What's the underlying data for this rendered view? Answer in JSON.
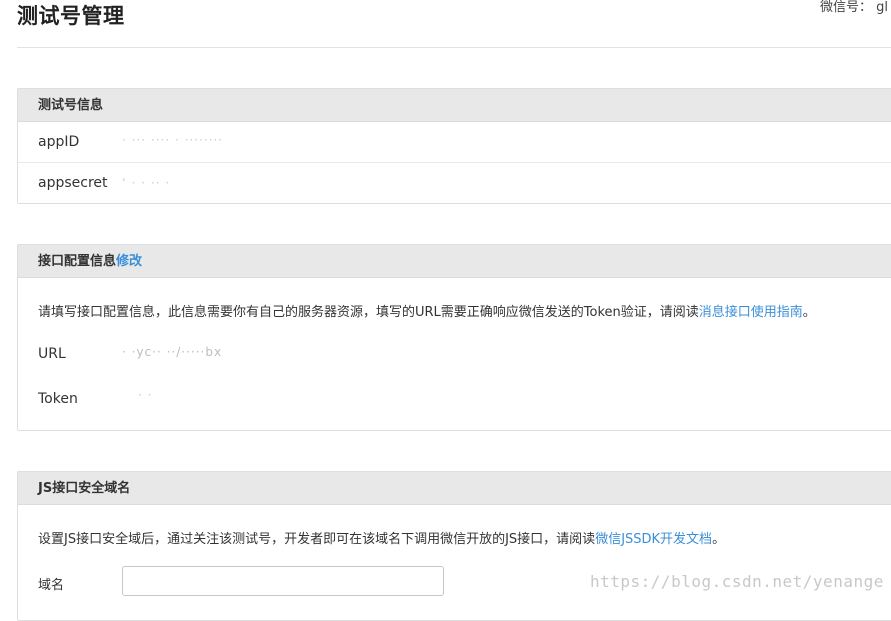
{
  "header": {
    "title": "测试号管理",
    "account_label": "微信号： gl"
  },
  "test_info": {
    "title": "测试号信息",
    "appid_label": "appID",
    "appid_value": "· ··· ···· · ········",
    "appsecret_label": "appsecret",
    "appsecret_value": "‘ ·   ·                        ·· ·"
  },
  "interface": {
    "title": "接口配置信息",
    "edit_link": "修改",
    "desc_prefix": "请填写接口配置信息，此信息需要你有自己的服务器资源，填写的URL需要正确响应微信发送的Token验证，请阅读",
    "desc_link": "消息接口使用指南",
    "desc_suffix": "。",
    "url_label": "URL",
    "url_value": "·            ·yc·· ··/·····bx",
    "token_label": "Token",
    "token_value": "· ·"
  },
  "js_domain": {
    "title": "JS接口安全域名",
    "desc_prefix": "设置JS接口安全域后，通过关注该测试号，开发者即可在该域名下调用微信开放的JS接口，请阅读",
    "desc_link": "微信JSSDK开发文档",
    "desc_suffix": "。",
    "domain_label": "域名",
    "domain_value": ""
  },
  "watermark": "https://blog.csdn.net/yenange",
  "colors": {
    "link": "#3a8fd9",
    "panel_header_bg": "#e8e8e8"
  }
}
